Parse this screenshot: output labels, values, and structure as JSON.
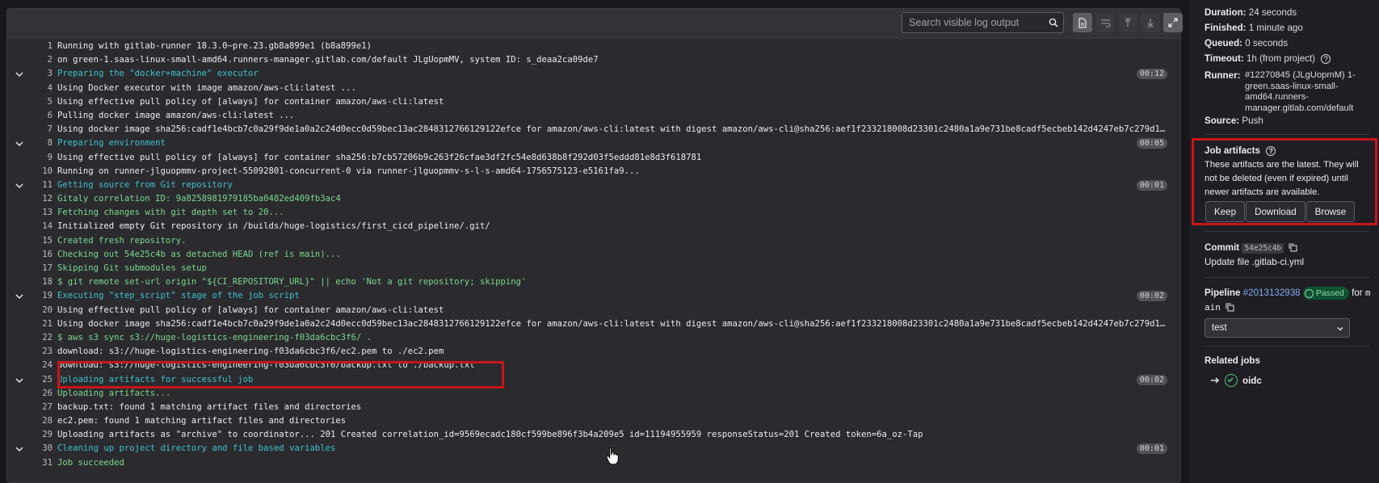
{
  "toolbar": {
    "search_placeholder": "Search visible log output"
  },
  "log_lines": [
    {
      "n": "1",
      "text": "Running with gitlab-runner 18.3.0~pre.23.gb8a899e1 (b8a899e1)",
      "cls": "c-def",
      "chevron": false,
      "dur": ""
    },
    {
      "n": "2",
      "text": "  on green-1.saas-linux-small-amd64.runners-manager.gitlab.com/default JLgUopmMV, system ID: s_deaa2ca09de7",
      "cls": "c-def",
      "chevron": false,
      "dur": ""
    },
    {
      "n": "3",
      "text": "Preparing the \"docker+machine\" executor",
      "cls": "c-sec",
      "chevron": true,
      "dur": "00:12"
    },
    {
      "n": "4",
      "text": "Using Docker executor with image amazon/aws-cli:latest ...",
      "cls": "c-def",
      "chevron": false,
      "dur": ""
    },
    {
      "n": "5",
      "text": "Using effective pull policy of [always] for container amazon/aws-cli:latest",
      "cls": "c-def",
      "chevron": false,
      "dur": ""
    },
    {
      "n": "6",
      "text": "Pulling docker image amazon/aws-cli:latest ...",
      "cls": "c-def",
      "chevron": false,
      "dur": ""
    },
    {
      "n": "7",
      "text": "Using docker image sha256:cadf1e4bcb7c0a29f9de1a0a2c24d0ecc0d59bec13ac2848312766129122efce for amazon/aws-cli:latest with digest amazon/aws-cli@sha256:aef1f233218008d23301c2480a1a9e731be8cadf5ecbeb142d4247eb7c279d1a ...",
      "cls": "c-def",
      "chevron": false,
      "dur": ""
    },
    {
      "n": "8",
      "text": "Preparing environment",
      "cls": "c-sec",
      "chevron": true,
      "dur": "00:05"
    },
    {
      "n": "9",
      "text": "Using effective pull policy of [always] for container sha256:b7cb57206b9c263f26cfae3df2fc54e8d638b8f292d03f5eddd81e8d3f618781",
      "cls": "c-def",
      "chevron": false,
      "dur": ""
    },
    {
      "n": "10",
      "text": "Running on runner-jlguopmmv-project-55092801-concurrent-0 via runner-jlguopmmv-s-l-s-amd64-1756575123-e5161fa9...",
      "cls": "c-def",
      "chevron": false,
      "dur": ""
    },
    {
      "n": "11",
      "text": "Getting source from Git repository",
      "cls": "c-sec",
      "chevron": true,
      "dur": "00:01"
    },
    {
      "n": "12",
      "text": "Gitaly correlation ID: 9a8258981979185ba0482ed409fb3ac4",
      "cls": "c-grn",
      "chevron": false,
      "dur": ""
    },
    {
      "n": "13",
      "text": "Fetching changes with git depth set to 20...",
      "cls": "c-grn",
      "chevron": false,
      "dur": ""
    },
    {
      "n": "14",
      "text": "Initialized empty Git repository in /builds/huge-logistics/first_cicd_pipeline/.git/",
      "cls": "c-def",
      "chevron": false,
      "dur": ""
    },
    {
      "n": "15",
      "text": "Created fresh repository.",
      "cls": "c-grn",
      "chevron": false,
      "dur": ""
    },
    {
      "n": "16",
      "text": "Checking out 54e25c4b as detached HEAD (ref is main)...",
      "cls": "c-grn",
      "chevron": false,
      "dur": ""
    },
    {
      "n": "17",
      "text": "Skipping Git submodules setup",
      "cls": "c-grn",
      "chevron": false,
      "dur": ""
    },
    {
      "n": "18",
      "text": "$ git remote set-url origin \"${CI_REPOSITORY_URL}\" || echo 'Not a git repository; skipping'",
      "cls": "c-grn",
      "chevron": false,
      "dur": ""
    },
    {
      "n": "19",
      "text": "Executing \"step_script\" stage of the job script",
      "cls": "c-sec",
      "chevron": true,
      "dur": "00:02"
    },
    {
      "n": "20",
      "text": "Using effective pull policy of [always] for container amazon/aws-cli:latest",
      "cls": "c-def",
      "chevron": false,
      "dur": ""
    },
    {
      "n": "21",
      "text": "Using docker image sha256:cadf1e4bcb7c0a29f9de1a0a2c24d0ecc0d59bec13ac2848312766129122efce for amazon/aws-cli:latest with digest amazon/aws-cli@sha256:aef1f233218008d23301c2480a1a9e731be8cadf5ecbeb142d4247eb7c279d1a ...",
      "cls": "c-def",
      "chevron": false,
      "dur": ""
    },
    {
      "n": "22",
      "text": "$ aws s3 sync s3://huge-logistics-engineering-f03da6cbc3f6/ .",
      "cls": "c-grn",
      "chevron": false,
      "dur": ""
    },
    {
      "n": "23",
      "text": "download: s3://huge-logistics-engineering-f03da6cbc3f6/ec2.pem to ./ec2.pem",
      "cls": "c-def",
      "chevron": false,
      "dur": ""
    },
    {
      "n": "24",
      "text": "download: s3://huge-logistics-engineering-f03da6cbc3f6/backup.txt to ./backup.txt",
      "cls": "c-def",
      "chevron": false,
      "dur": ""
    },
    {
      "n": "25",
      "text": "Uploading artifacts for successful job",
      "cls": "c-sec",
      "chevron": true,
      "dur": "00:02"
    },
    {
      "n": "26",
      "text": "Uploading artifacts...",
      "cls": "c-grn",
      "chevron": false,
      "dur": ""
    },
    {
      "n": "27",
      "text": "backup.txt: found 1 matching artifact files and directories",
      "cls": "c-def",
      "chevron": false,
      "dur": ""
    },
    {
      "n": "28",
      "text": "ec2.pem: found 1 matching artifact files and directories",
      "cls": "c-def",
      "chevron": false,
      "dur": ""
    },
    {
      "n": "29",
      "text": "Uploading artifacts as \"archive\" to coordinator... 201 Created  correlation_id=9569ecadc180cf599be896f3b4a209e5 id=11194955959 responseStatus=201 Created token=6a_oz-Tap",
      "cls": "c-def",
      "chevron": false,
      "dur": ""
    },
    {
      "n": "30",
      "text": "Cleaning up project directory and file based variables",
      "cls": "c-sec",
      "chevron": true,
      "dur": "00:01"
    },
    {
      "n": "31",
      "text": "Job succeeded",
      "cls": "c-grn",
      "chevron": false,
      "dur": ""
    }
  ],
  "sidebar": {
    "duration_label": "Duration:",
    "duration_value": "24 seconds",
    "finished_label": "Finished:",
    "finished_value": "1 minute ago",
    "queued_label": "Queued:",
    "queued_value": "0 seconds",
    "timeout_label": "Timeout:",
    "timeout_value": "1h (from project)",
    "runner_label": "Runner:",
    "runner_value": "#12270845 (JLgUopmM) 1-green.saas-linux-small-amd64.runners-manager.gitlab.com/default",
    "source_label": "Source:",
    "source_value": "Push",
    "artifacts_title": "Job artifacts",
    "artifacts_desc": "These artifacts are the latest. They will not be deleted (even if expired) until newer artifacts are available.",
    "keep_label": "Keep",
    "download_label": "Download",
    "browse_label": "Browse",
    "commit_label": "Commit",
    "commit_sha": "54e25c4b",
    "commit_message": "Update file .gitlab-ci.yml",
    "pipeline_label": "Pipeline",
    "pipeline_id": "#2013132938",
    "passed_label": "Passed",
    "for_text": "for",
    "branch_part1": "m",
    "branch_part2": "ain",
    "stage_select": "test",
    "related_jobs_title": "Related jobs",
    "related_job_name": "oidc"
  },
  "colors": {
    "highlight_box": "#c9151a",
    "section_header": "#3ec1cb",
    "success_text": "#7bd88f",
    "link": "#7fa9f0"
  }
}
